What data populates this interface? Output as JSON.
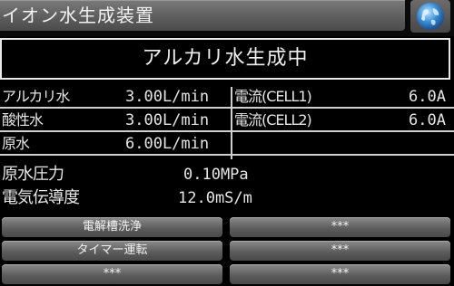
{
  "header": {
    "title": "イオン水生成装置",
    "language_button_icon": "globe-icon"
  },
  "status": {
    "text": "アルカリ水生成中"
  },
  "readings": {
    "alkaline_water": {
      "label": "アルカリ水",
      "value": "3.00L/min"
    },
    "acidic_water": {
      "label": "酸性水",
      "value": "3.00L/min"
    },
    "raw_water": {
      "label": "原水",
      "value": "6.00L/min"
    },
    "current_cell1": {
      "label": "電流(CELL1)",
      "value": "6.0A"
    },
    "current_cell2": {
      "label": "電流(CELL2)",
      "value": "6.0A"
    },
    "raw_water_pressure": {
      "label": "原水圧力",
      "value": "0.10MPa"
    },
    "conductivity": {
      "label": "電気伝導度",
      "value": "12.0mS/m"
    }
  },
  "buttons": [
    {
      "label": "電解槽洗浄"
    },
    {
      "label": "***"
    },
    {
      "label": "タイマー運転"
    },
    {
      "label": "***"
    },
    {
      "label": "***"
    },
    {
      "label": "***"
    }
  ]
}
